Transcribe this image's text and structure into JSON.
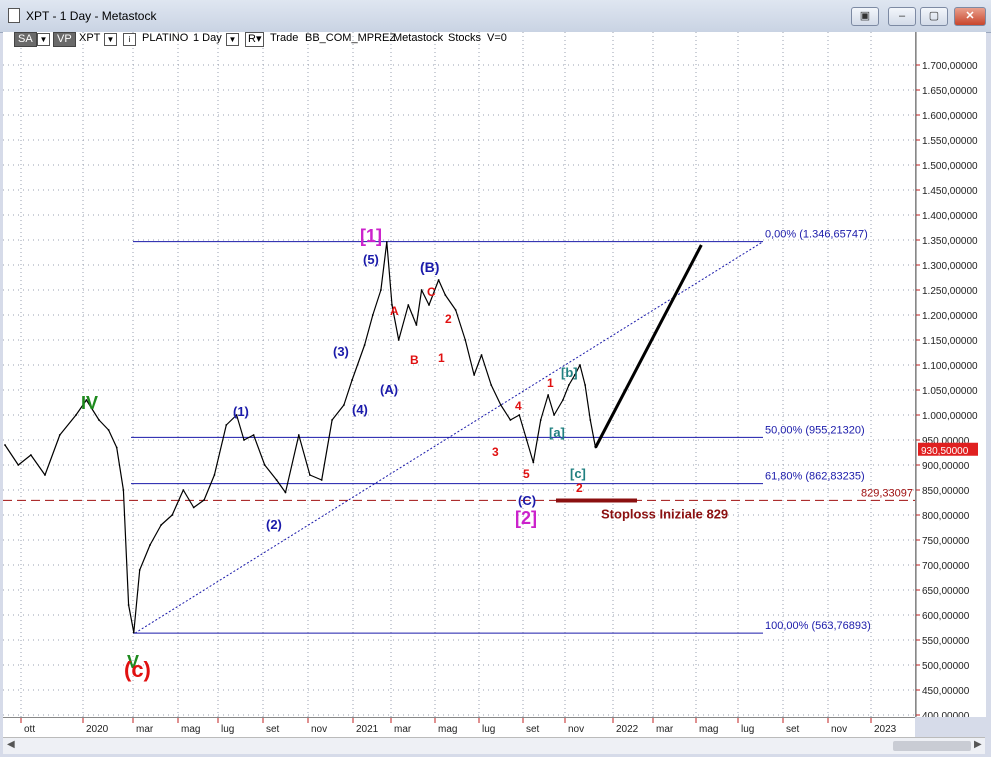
{
  "window": {
    "title": "XPT - 1 Day - Metastock",
    "buttons": [
      "▣",
      "–",
      "▢",
      "✕"
    ]
  },
  "toolbar": {
    "sa": "SA",
    "vp": "VP",
    "symbol": "XPT",
    "name": "PLATINO",
    "period": "1 Day",
    "r": "R",
    "trade": "Trade",
    "template": "BB_COM_MPREZ",
    "app": "Metastock",
    "stocks": "Stocks",
    "v": "V=0"
  },
  "chart_data": {
    "type": "line",
    "title": "",
    "x_months": [
      "ott",
      "2020",
      "mar",
      "mag",
      "lug",
      "set",
      "nov",
      "2021",
      "mar",
      "mag",
      "lug",
      "set",
      "nov",
      "2022",
      "mar",
      "mag",
      "lug",
      "set",
      "nov",
      "2023"
    ],
    "ylim": [
      400,
      1750
    ],
    "y_ticks": [
      "1.700,00000",
      "1.650,00000",
      "1.600,00000",
      "1.550,00000",
      "1.500,00000",
      "1.450,00000",
      "1.400,00000",
      "1.350,00000",
      "1.300,00000",
      "1.250,00000",
      "1.200,00000",
      "1.150,00000",
      "1.100,00000",
      "1.050,00000",
      "1.000,00000",
      "950,00000",
      "900,00000",
      "850,00000",
      "800,00000",
      "750,00000",
      "700,00000",
      "650,00000",
      "600,00000",
      "550,00000",
      "500,00000",
      "450,00000",
      "400,00000"
    ],
    "y_tick_values": [
      1700,
      1650,
      1600,
      1550,
      1500,
      1450,
      1400,
      1350,
      1300,
      1250,
      1200,
      1150,
      1100,
      1050,
      1000,
      950,
      900,
      850,
      800,
      750,
      700,
      650,
      600,
      550,
      500,
      450,
      400
    ],
    "series": [
      {
        "x": [
          "2019-09-27",
          "2019-10-15",
          "2019-11-01",
          "2019-11-20",
          "2019-12-10",
          "2020-01-01",
          "2020-01-15",
          "2020-02-01",
          "2020-02-14",
          "2020-02-25",
          "2020-03-05",
          "2020-03-12",
          "2020-03-19",
          "2020-03-27",
          "2020-04-10",
          "2020-04-25",
          "2020-05-10",
          "2020-05-25",
          "2020-06-08",
          "2020-06-22",
          "2020-07-06",
          "2020-07-22",
          "2020-08-05",
          "2020-08-15",
          "2020-08-28",
          "2020-09-12",
          "2020-09-28",
          "2020-10-10",
          "2020-10-28",
          "2020-11-12",
          "2020-11-28",
          "2020-12-12",
          "2020-12-28",
          "2021-01-08",
          "2021-01-25",
          "2021-02-05",
          "2021-02-16",
          "2021-02-24",
          "2021-03-03",
          "2021-03-12",
          "2021-03-25",
          "2021-04-05",
          "2021-04-12",
          "2021-04-22",
          "2021-05-05",
          "2021-05-14",
          "2021-05-28",
          "2021-06-10",
          "2021-06-22",
          "2021-07-02",
          "2021-07-15",
          "2021-07-28",
          "2021-08-10",
          "2021-08-22",
          "2021-09-01",
          "2021-09-10",
          "2021-09-20",
          "2021-09-30",
          "2021-10-08",
          "2021-10-20",
          "2021-10-28",
          "2021-11-05",
          "2021-11-12",
          "2021-11-19",
          "2021-11-26",
          "2021-12-03"
        ],
        "values": [
          940,
          900,
          920,
          880,
          960,
          1000,
          1030,
          990,
          970,
          935,
          850,
          620,
          565,
          690,
          740,
          780,
          800,
          850,
          815,
          830,
          880,
          980,
          1000,
          950,
          960,
          900,
          870,
          845,
          960,
          880,
          870,
          990,
          1020,
          1070,
          1140,
          1200,
          1250,
          1346,
          1220,
          1150,
          1220,
          1180,
          1250,
          1220,
          1270,
          1240,
          1210,
          1150,
          1080,
          1120,
          1060,
          1020,
          990,
          1000,
          950,
          905,
          990,
          1040,
          1000,
          1030,
          1060,
          1080,
          1100,
          1060,
          990,
          935
        ]
      }
    ],
    "projection": {
      "x": [
        "2021-12-03",
        "2022-04-25"
      ],
      "values": [
        935,
        1340
      ]
    },
    "horizontal_lines": [
      {
        "value": 1346.65747,
        "label": "0,00% (1.346,65747)"
      },
      {
        "value": 955.2132,
        "label": "50,00% (955,21320)"
      },
      {
        "value": 862.83235,
        "label": "61,80% (862,83235)"
      },
      {
        "value": 563.76893,
        "label": "100,00% (563,76893)"
      }
    ],
    "dashed_line": {
      "value": 829.33097,
      "label": "829,33097"
    },
    "last_price": {
      "value": 930.5,
      "label": "930,50000"
    },
    "stoploss": {
      "value": 829,
      "label": "Stoploss Iniziale 829"
    },
    "wave_labels": [
      {
        "text": "IV",
        "color": "#1e8a1e"
      },
      {
        "text": "V",
        "color": "#1e8a1e"
      },
      {
        "text": "(c)",
        "color": "#e01010"
      },
      {
        "text": "[1]",
        "color": "#cc22cc"
      },
      {
        "text": "[2]",
        "color": "#cc22cc"
      },
      {
        "text": "(1)",
        "color": "#1a1aaa"
      },
      {
        "text": "(2)",
        "color": "#1a1aaa"
      },
      {
        "text": "(3)",
        "color": "#1a1aaa"
      },
      {
        "text": "(4)",
        "color": "#1a1aaa"
      },
      {
        "text": "(5)",
        "color": "#1a1aaa"
      },
      {
        "text": "(A)",
        "color": "#1a1aaa"
      },
      {
        "text": "(B)",
        "color": "#1a1aaa"
      },
      {
        "text": "(C)",
        "color": "#1a1aaa"
      },
      {
        "text": "A",
        "color": "#e01010"
      },
      {
        "text": "B",
        "color": "#e01010"
      },
      {
        "text": "C",
        "color": "#e01010"
      },
      {
        "text": "1",
        "color": "#e01010"
      },
      {
        "text": "2",
        "color": "#e01010"
      },
      {
        "text": "3",
        "color": "#e01010"
      },
      {
        "text": "4",
        "color": "#e01010"
      },
      {
        "text": "5",
        "color": "#e01010"
      },
      {
        "text": "1",
        "color": "#e01010"
      },
      {
        "text": "2",
        "color": "#e01010"
      },
      {
        "text": "[a]",
        "color": "#208080"
      },
      {
        "text": "[b]",
        "color": "#208080"
      },
      {
        "text": "[c]",
        "color": "#208080"
      }
    ],
    "colors": {
      "price": "#000000",
      "fib": "#1a1aaa",
      "dashed": "#a01010",
      "stoploss": "#8b1010",
      "projection": "#000000"
    }
  }
}
